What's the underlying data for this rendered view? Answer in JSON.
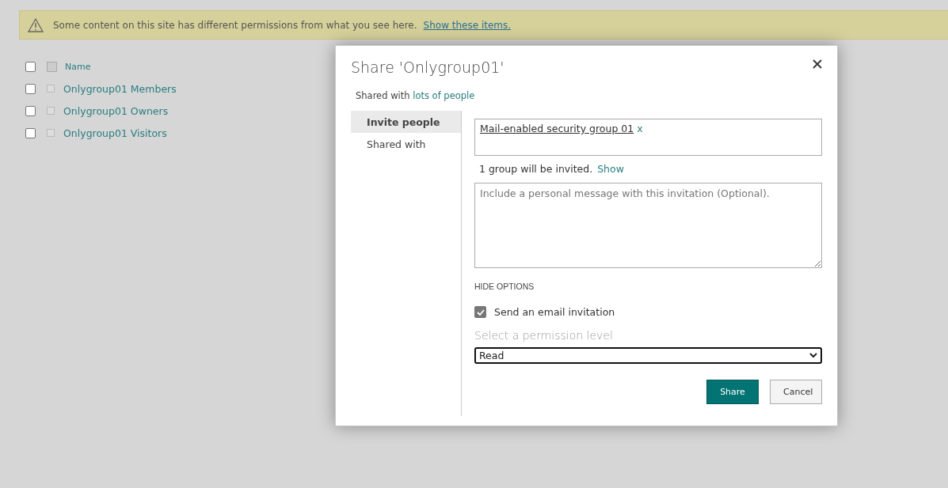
{
  "banner": {
    "message": "Some content on this site has different permissions from what you see here.",
    "link": "Show these items."
  },
  "list": {
    "header": {
      "label": "Name",
      "selected": false
    },
    "rows": [
      {
        "name": "Onlygroup01 Members",
        "selected": false
      },
      {
        "name": "Onlygroup01 Owners",
        "selected": false
      },
      {
        "name": "Onlygroup01 Visitors",
        "selected": false
      }
    ]
  },
  "dialog": {
    "title": "Share 'Onlygroup01'",
    "shared_prefix": "Shared with",
    "shared_link": "lots of people",
    "tabs": [
      {
        "label": "Invite people",
        "selected": true
      },
      {
        "label": "Shared with",
        "selected": false
      }
    ],
    "invitees": [
      {
        "name": "Mail-enabled security group 01",
        "remove": "x"
      }
    ],
    "invite_summary": "1 group will be invited.",
    "show_link": "Show",
    "message": {
      "placeholder": "Include a personal message with this invitation (Optional)."
    },
    "options_toggle": "HIDE OPTIONS",
    "send_email": {
      "label": "Send an email invitation",
      "checked": true
    },
    "permission": {
      "label": "Select a permission level",
      "value": "Read"
    },
    "buttons": [
      {
        "label": "Share",
        "kind": "primary"
      },
      {
        "label": "Cancel",
        "kind": "secondary"
      }
    ]
  }
}
